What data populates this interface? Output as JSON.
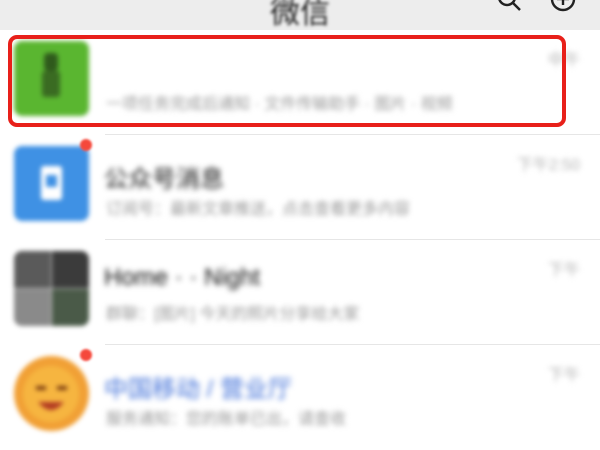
{
  "header": {
    "title": "微信",
    "search_icon": "search-icon",
    "add_icon": "plus-circle-icon"
  },
  "chats": [
    {
      "name": "",
      "preview": "一项任务完成后通知 · 文件传输助手 · 图片 · 视频",
      "time": "中午",
      "avatar_color": "#5ab630",
      "unread": false
    },
    {
      "name": "公众号消息",
      "preview": "订阅号：最新文章推送，点击查看更多内容",
      "time": "下午2:50",
      "avatar_color": "#3f91e4",
      "unread": true
    },
    {
      "name": "Home · · Night",
      "preview": "群聊：[图片] 今天的照片分享给大家",
      "time": "下午",
      "avatar_color": "#6f6f6f",
      "unread": false
    },
    {
      "name": "中国移动 / 营业厅",
      "preview": "服务通知：您的账单已出，请查收",
      "time": "下午",
      "avatar_color": "#f1a035",
      "unread": true
    }
  ],
  "colors": {
    "highlight": "#e8201a",
    "badge": "#f5483b",
    "header_bg": "#ededed"
  }
}
